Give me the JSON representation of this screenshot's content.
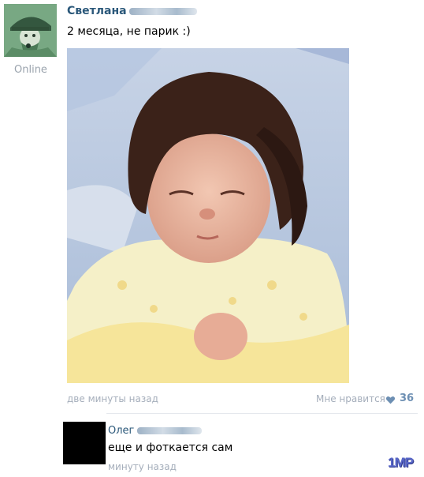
{
  "post": {
    "author_name": "Светлана",
    "status": "Online",
    "text": "2 месяца, не парик :)",
    "time": "две минуты назад",
    "like_label": "Мне нравится",
    "like_count": "36"
  },
  "comment": {
    "author_name": "Олег",
    "text": "еще и фоткается сам",
    "time": "минуту назад"
  },
  "watermark": "1MP",
  "colors": {
    "link": "#2b587a",
    "muted": "#a5aebb",
    "like_accent": "#6d8fb3"
  },
  "icons": {
    "like": "heart-icon"
  }
}
